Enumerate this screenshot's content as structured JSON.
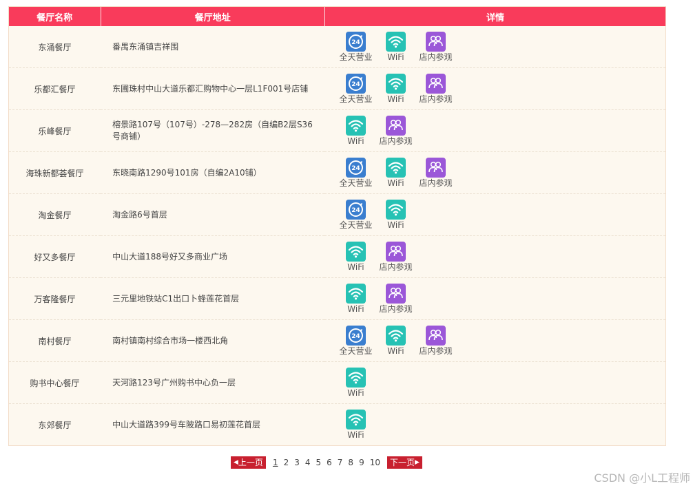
{
  "table": {
    "headers": [
      "餐厅名称",
      "餐厅地址",
      "详情"
    ],
    "rows": [
      {
        "name": "东涌餐厅",
        "address": "番禺东涌镇吉祥围",
        "features": [
          "allday",
          "wifi",
          "view"
        ]
      },
      {
        "name": "乐都汇餐厅",
        "address": "东圃珠村中山大道乐都汇购物中心一层L1F001号店铺",
        "features": [
          "allday",
          "wifi",
          "view"
        ]
      },
      {
        "name": "乐峰餐厅",
        "address": "榕景路107号（107号）-278—282房（自编B2层S36号商铺）",
        "features": [
          "wifi",
          "view"
        ]
      },
      {
        "name": "海珠新都荟餐厅",
        "address": "东晓南路1290号101房（自编2A10铺）",
        "features": [
          "allday",
          "wifi",
          "view"
        ]
      },
      {
        "name": "淘金餐厅",
        "address": "淘金路6号首层",
        "features": [
          "allday",
          "wifi"
        ]
      },
      {
        "name": "好又多餐厅",
        "address": "中山大道188号好又多商业广场",
        "features": [
          "wifi",
          "view"
        ]
      },
      {
        "name": "万客隆餐厅",
        "address": "三元里地铁站C1出口卜蜂莲花首层",
        "features": [
          "wifi",
          "view"
        ]
      },
      {
        "name": "南村餐厅",
        "address": "南村镇南村综合市场一楼西北角",
        "features": [
          "allday",
          "wifi",
          "view"
        ]
      },
      {
        "name": "购书中心餐厅",
        "address": "天河路123号广州购书中心负一层",
        "features": [
          "wifi"
        ]
      },
      {
        "name": "东郊餐厅",
        "address": "中山大道路399号车陂路口易初莲花首层",
        "features": [
          "wifi"
        ]
      }
    ]
  },
  "feature_labels": {
    "allday": "全天营业",
    "wifi": "WiFi",
    "view": "店内参观"
  },
  "feature_icons": {
    "allday": "24-hours-icon",
    "wifi": "wifi-icon",
    "view": "people-icon"
  },
  "pagination": {
    "prev_label": "上一页",
    "next_label": "下一页",
    "pages": [
      "1",
      "2",
      "3",
      "4",
      "5",
      "6",
      "7",
      "8",
      "9",
      "10"
    ],
    "current": "1"
  },
  "watermark": "CSDN @小L工程师",
  "colors": {
    "header_bg": "#f93b5b",
    "row_bg": "#fdf8ef",
    "allday_icon": "#3a7ecf",
    "wifi_icon": "#27c2b4",
    "view_icon": "#9b57d8",
    "pager_button": "#c8202f"
  }
}
